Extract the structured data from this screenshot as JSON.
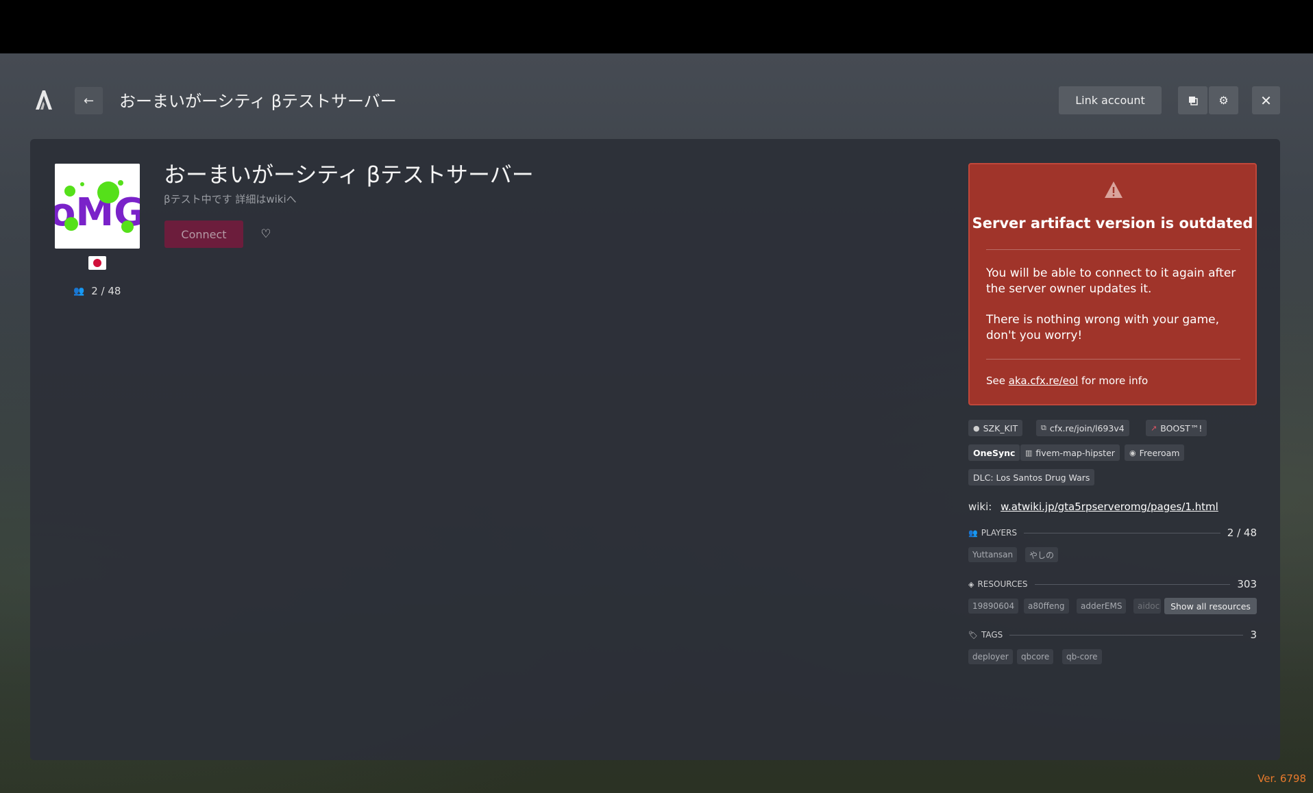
{
  "header": {
    "title": "おーまいがーシティ βテストサーバー",
    "link_account": "Link account"
  },
  "server": {
    "name": "おーまいがーシティ βテストサーバー",
    "description": "βテスト中です 詳細はwikiへ",
    "players": "2 / 48",
    "connect_label": "Connect",
    "country": "JP"
  },
  "warning": {
    "title": "Server artifact version is outdated",
    "p1": "You will be able to connect to it again after the server owner updates it.",
    "p2": "There is nothing wrong with your game, don't you worry!",
    "see_prefix": "See",
    "see_link": "aka.cfx.re/eol",
    "see_suffix": "for more info"
  },
  "chips": {
    "owner": "SZK_KIT",
    "join": "cfx.re/join/l693v4",
    "boost": "BOOST™!",
    "onesync": "OneSync",
    "map": "fivem-map-hipster",
    "gametype": "Freeroam",
    "dlc": "DLC: Los Santos Drug Wars"
  },
  "wiki": {
    "label": "wiki:",
    "url": "w.atwiki.jp/gta5rpserveromg/pages/1.html"
  },
  "players_section": {
    "label": "PLAYERS",
    "count": "2 / 48",
    "items": [
      "Yuttansan",
      "やしの"
    ]
  },
  "resources_section": {
    "label": "RESOURCES",
    "count": "303",
    "items": [
      "19890604",
      "a80ffeng",
      "adderEMS",
      "aidoc"
    ],
    "show_all": "Show all resources"
  },
  "tags_section": {
    "label": "TAGS",
    "count": "3",
    "items": [
      "deployer",
      "qbcore",
      "qb-core"
    ]
  },
  "version": "Ver. 6798",
  "colors": {
    "warning_bg": "#a0342a",
    "connect_bg": "#6c1d3c",
    "version_text": "#e87a2c"
  }
}
